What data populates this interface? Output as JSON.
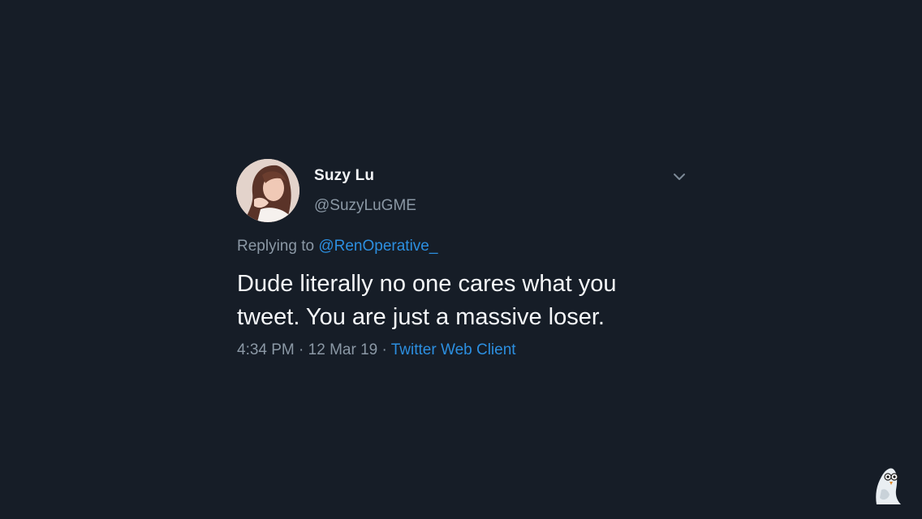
{
  "tweet": {
    "author": {
      "display_name": "Suzy Lu",
      "handle": "@SuzyLuGME",
      "avatar_icon": "profile-photo"
    },
    "menu_icon": "chevron-down-icon",
    "reply": {
      "prefix": "Replying to",
      "mention": "@RenOperative_"
    },
    "text_line1": "Dude literally no one cares what you",
    "text_line2": "tweet. You are just a massive loser.",
    "time": "4:34 PM",
    "separator": "·",
    "date": "12 Mar 19",
    "source": "Twitter Web Client"
  },
  "colors": {
    "background": "#161d27",
    "text": "#f5f7f9",
    "muted": "#8b98a5",
    "link": "#2c8fe0"
  },
  "watermark_icon": "ghost-mascot-icon"
}
